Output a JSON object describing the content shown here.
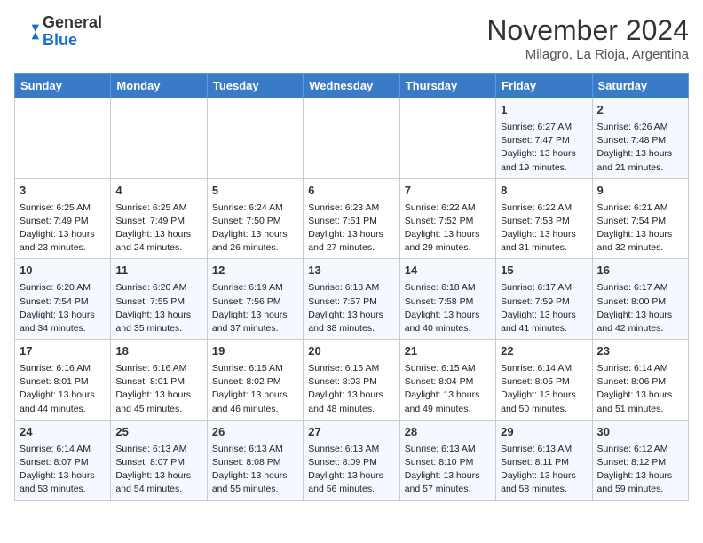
{
  "logo": {
    "line1": "General",
    "line2": "Blue"
  },
  "header": {
    "month": "November 2024",
    "location": "Milagro, La Rioja, Argentina"
  },
  "weekdays": [
    "Sunday",
    "Monday",
    "Tuesday",
    "Wednesday",
    "Thursday",
    "Friday",
    "Saturday"
  ],
  "weeks": [
    [
      {
        "day": "",
        "info": ""
      },
      {
        "day": "",
        "info": ""
      },
      {
        "day": "",
        "info": ""
      },
      {
        "day": "",
        "info": ""
      },
      {
        "day": "",
        "info": ""
      },
      {
        "day": "1",
        "info": "Sunrise: 6:27 AM\nSunset: 7:47 PM\nDaylight: 13 hours and 19 minutes."
      },
      {
        "day": "2",
        "info": "Sunrise: 6:26 AM\nSunset: 7:48 PM\nDaylight: 13 hours and 21 minutes."
      }
    ],
    [
      {
        "day": "3",
        "info": "Sunrise: 6:25 AM\nSunset: 7:49 PM\nDaylight: 13 hours and 23 minutes."
      },
      {
        "day": "4",
        "info": "Sunrise: 6:25 AM\nSunset: 7:49 PM\nDaylight: 13 hours and 24 minutes."
      },
      {
        "day": "5",
        "info": "Sunrise: 6:24 AM\nSunset: 7:50 PM\nDaylight: 13 hours and 26 minutes."
      },
      {
        "day": "6",
        "info": "Sunrise: 6:23 AM\nSunset: 7:51 PM\nDaylight: 13 hours and 27 minutes."
      },
      {
        "day": "7",
        "info": "Sunrise: 6:22 AM\nSunset: 7:52 PM\nDaylight: 13 hours and 29 minutes."
      },
      {
        "day": "8",
        "info": "Sunrise: 6:22 AM\nSunset: 7:53 PM\nDaylight: 13 hours and 31 minutes."
      },
      {
        "day": "9",
        "info": "Sunrise: 6:21 AM\nSunset: 7:54 PM\nDaylight: 13 hours and 32 minutes."
      }
    ],
    [
      {
        "day": "10",
        "info": "Sunrise: 6:20 AM\nSunset: 7:54 PM\nDaylight: 13 hours and 34 minutes."
      },
      {
        "day": "11",
        "info": "Sunrise: 6:20 AM\nSunset: 7:55 PM\nDaylight: 13 hours and 35 minutes."
      },
      {
        "day": "12",
        "info": "Sunrise: 6:19 AM\nSunset: 7:56 PM\nDaylight: 13 hours and 37 minutes."
      },
      {
        "day": "13",
        "info": "Sunrise: 6:18 AM\nSunset: 7:57 PM\nDaylight: 13 hours and 38 minutes."
      },
      {
        "day": "14",
        "info": "Sunrise: 6:18 AM\nSunset: 7:58 PM\nDaylight: 13 hours and 40 minutes."
      },
      {
        "day": "15",
        "info": "Sunrise: 6:17 AM\nSunset: 7:59 PM\nDaylight: 13 hours and 41 minutes."
      },
      {
        "day": "16",
        "info": "Sunrise: 6:17 AM\nSunset: 8:00 PM\nDaylight: 13 hours and 42 minutes."
      }
    ],
    [
      {
        "day": "17",
        "info": "Sunrise: 6:16 AM\nSunset: 8:01 PM\nDaylight: 13 hours and 44 minutes."
      },
      {
        "day": "18",
        "info": "Sunrise: 6:16 AM\nSunset: 8:01 PM\nDaylight: 13 hours and 45 minutes."
      },
      {
        "day": "19",
        "info": "Sunrise: 6:15 AM\nSunset: 8:02 PM\nDaylight: 13 hours and 46 minutes."
      },
      {
        "day": "20",
        "info": "Sunrise: 6:15 AM\nSunset: 8:03 PM\nDaylight: 13 hours and 48 minutes."
      },
      {
        "day": "21",
        "info": "Sunrise: 6:15 AM\nSunset: 8:04 PM\nDaylight: 13 hours and 49 minutes."
      },
      {
        "day": "22",
        "info": "Sunrise: 6:14 AM\nSunset: 8:05 PM\nDaylight: 13 hours and 50 minutes."
      },
      {
        "day": "23",
        "info": "Sunrise: 6:14 AM\nSunset: 8:06 PM\nDaylight: 13 hours and 51 minutes."
      }
    ],
    [
      {
        "day": "24",
        "info": "Sunrise: 6:14 AM\nSunset: 8:07 PM\nDaylight: 13 hours and 53 minutes."
      },
      {
        "day": "25",
        "info": "Sunrise: 6:13 AM\nSunset: 8:07 PM\nDaylight: 13 hours and 54 minutes."
      },
      {
        "day": "26",
        "info": "Sunrise: 6:13 AM\nSunset: 8:08 PM\nDaylight: 13 hours and 55 minutes."
      },
      {
        "day": "27",
        "info": "Sunrise: 6:13 AM\nSunset: 8:09 PM\nDaylight: 13 hours and 56 minutes."
      },
      {
        "day": "28",
        "info": "Sunrise: 6:13 AM\nSunset: 8:10 PM\nDaylight: 13 hours and 57 minutes."
      },
      {
        "day": "29",
        "info": "Sunrise: 6:13 AM\nSunset: 8:11 PM\nDaylight: 13 hours and 58 minutes."
      },
      {
        "day": "30",
        "info": "Sunrise: 6:12 AM\nSunset: 8:12 PM\nDaylight: 13 hours and 59 minutes."
      }
    ]
  ]
}
